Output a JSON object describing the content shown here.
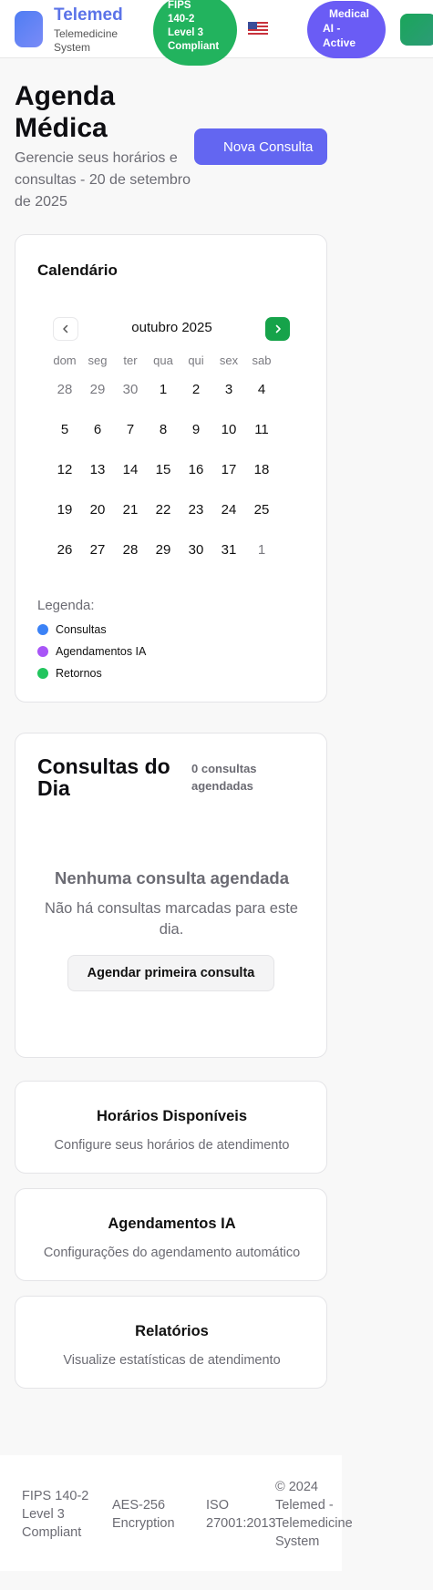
{
  "header": {
    "brand_title": "Telemed",
    "brand_subtitle": "Telemedicine System",
    "fips_badge": [
      "FIPS",
      "140-2",
      "Level 3",
      "Compliant"
    ],
    "flag": "🇺🇸",
    "ai_badge": [
      "Medical",
      "AI -",
      "Active"
    ]
  },
  "page": {
    "title": "Agenda Médica",
    "subtitle": "Gerencie seus horários e consultas - 20 de setembro de 2025",
    "new_button": "Nova Consulta"
  },
  "calendar": {
    "title": "Calendário",
    "month_label": "outubro 2025",
    "weekdays": [
      "dom",
      "seg",
      "ter",
      "qua",
      "qui",
      "sex",
      "sab"
    ],
    "weeks": [
      [
        "28",
        "29",
        "30",
        "1",
        "2",
        "3",
        "4"
      ],
      [
        "5",
        "6",
        "7",
        "8",
        "9",
        "10",
        "11"
      ],
      [
        "12",
        "13",
        "14",
        "15",
        "16",
        "17",
        "18"
      ],
      [
        "19",
        "20",
        "21",
        "22",
        "23",
        "24",
        "25"
      ],
      [
        "26",
        "27",
        "28",
        "29",
        "30",
        "31",
        "1"
      ]
    ],
    "legend_title": "Legenda:",
    "legend": [
      {
        "label": "Consultas",
        "color": "#3b82f6"
      },
      {
        "label": "Agendamentos IA",
        "color": "#a855f7"
      },
      {
        "label": "Retornos",
        "color": "#22c55e"
      }
    ]
  },
  "day": {
    "title": "Consultas do Dia",
    "count": "0 consultas agendadas",
    "empty_title": "Nenhuma consulta agendada",
    "empty_text": "Não há consultas marcadas para este dia.",
    "first_button": "Agendar primeira consulta"
  },
  "cards": [
    {
      "title": "Horários Disponíveis",
      "desc": "Configure seus horários de atendimento"
    },
    {
      "title": "Agendamentos IA",
      "desc": "Configurações do agendamento automático"
    },
    {
      "title": "Relatórios",
      "desc": "Visualize estatísticas de atendimento"
    }
  ],
  "footer": {
    "fips": "FIPS 140-2 Level 3 Compliant",
    "aes": "AES-256 Encryption",
    "iso": "ISO 27001:2013",
    "copyright": "© 2024 Telemed - Telemedicine System"
  },
  "colors": {
    "primary": "#6366f1",
    "success": "#16a34a",
    "brand": "#5b73e8"
  }
}
